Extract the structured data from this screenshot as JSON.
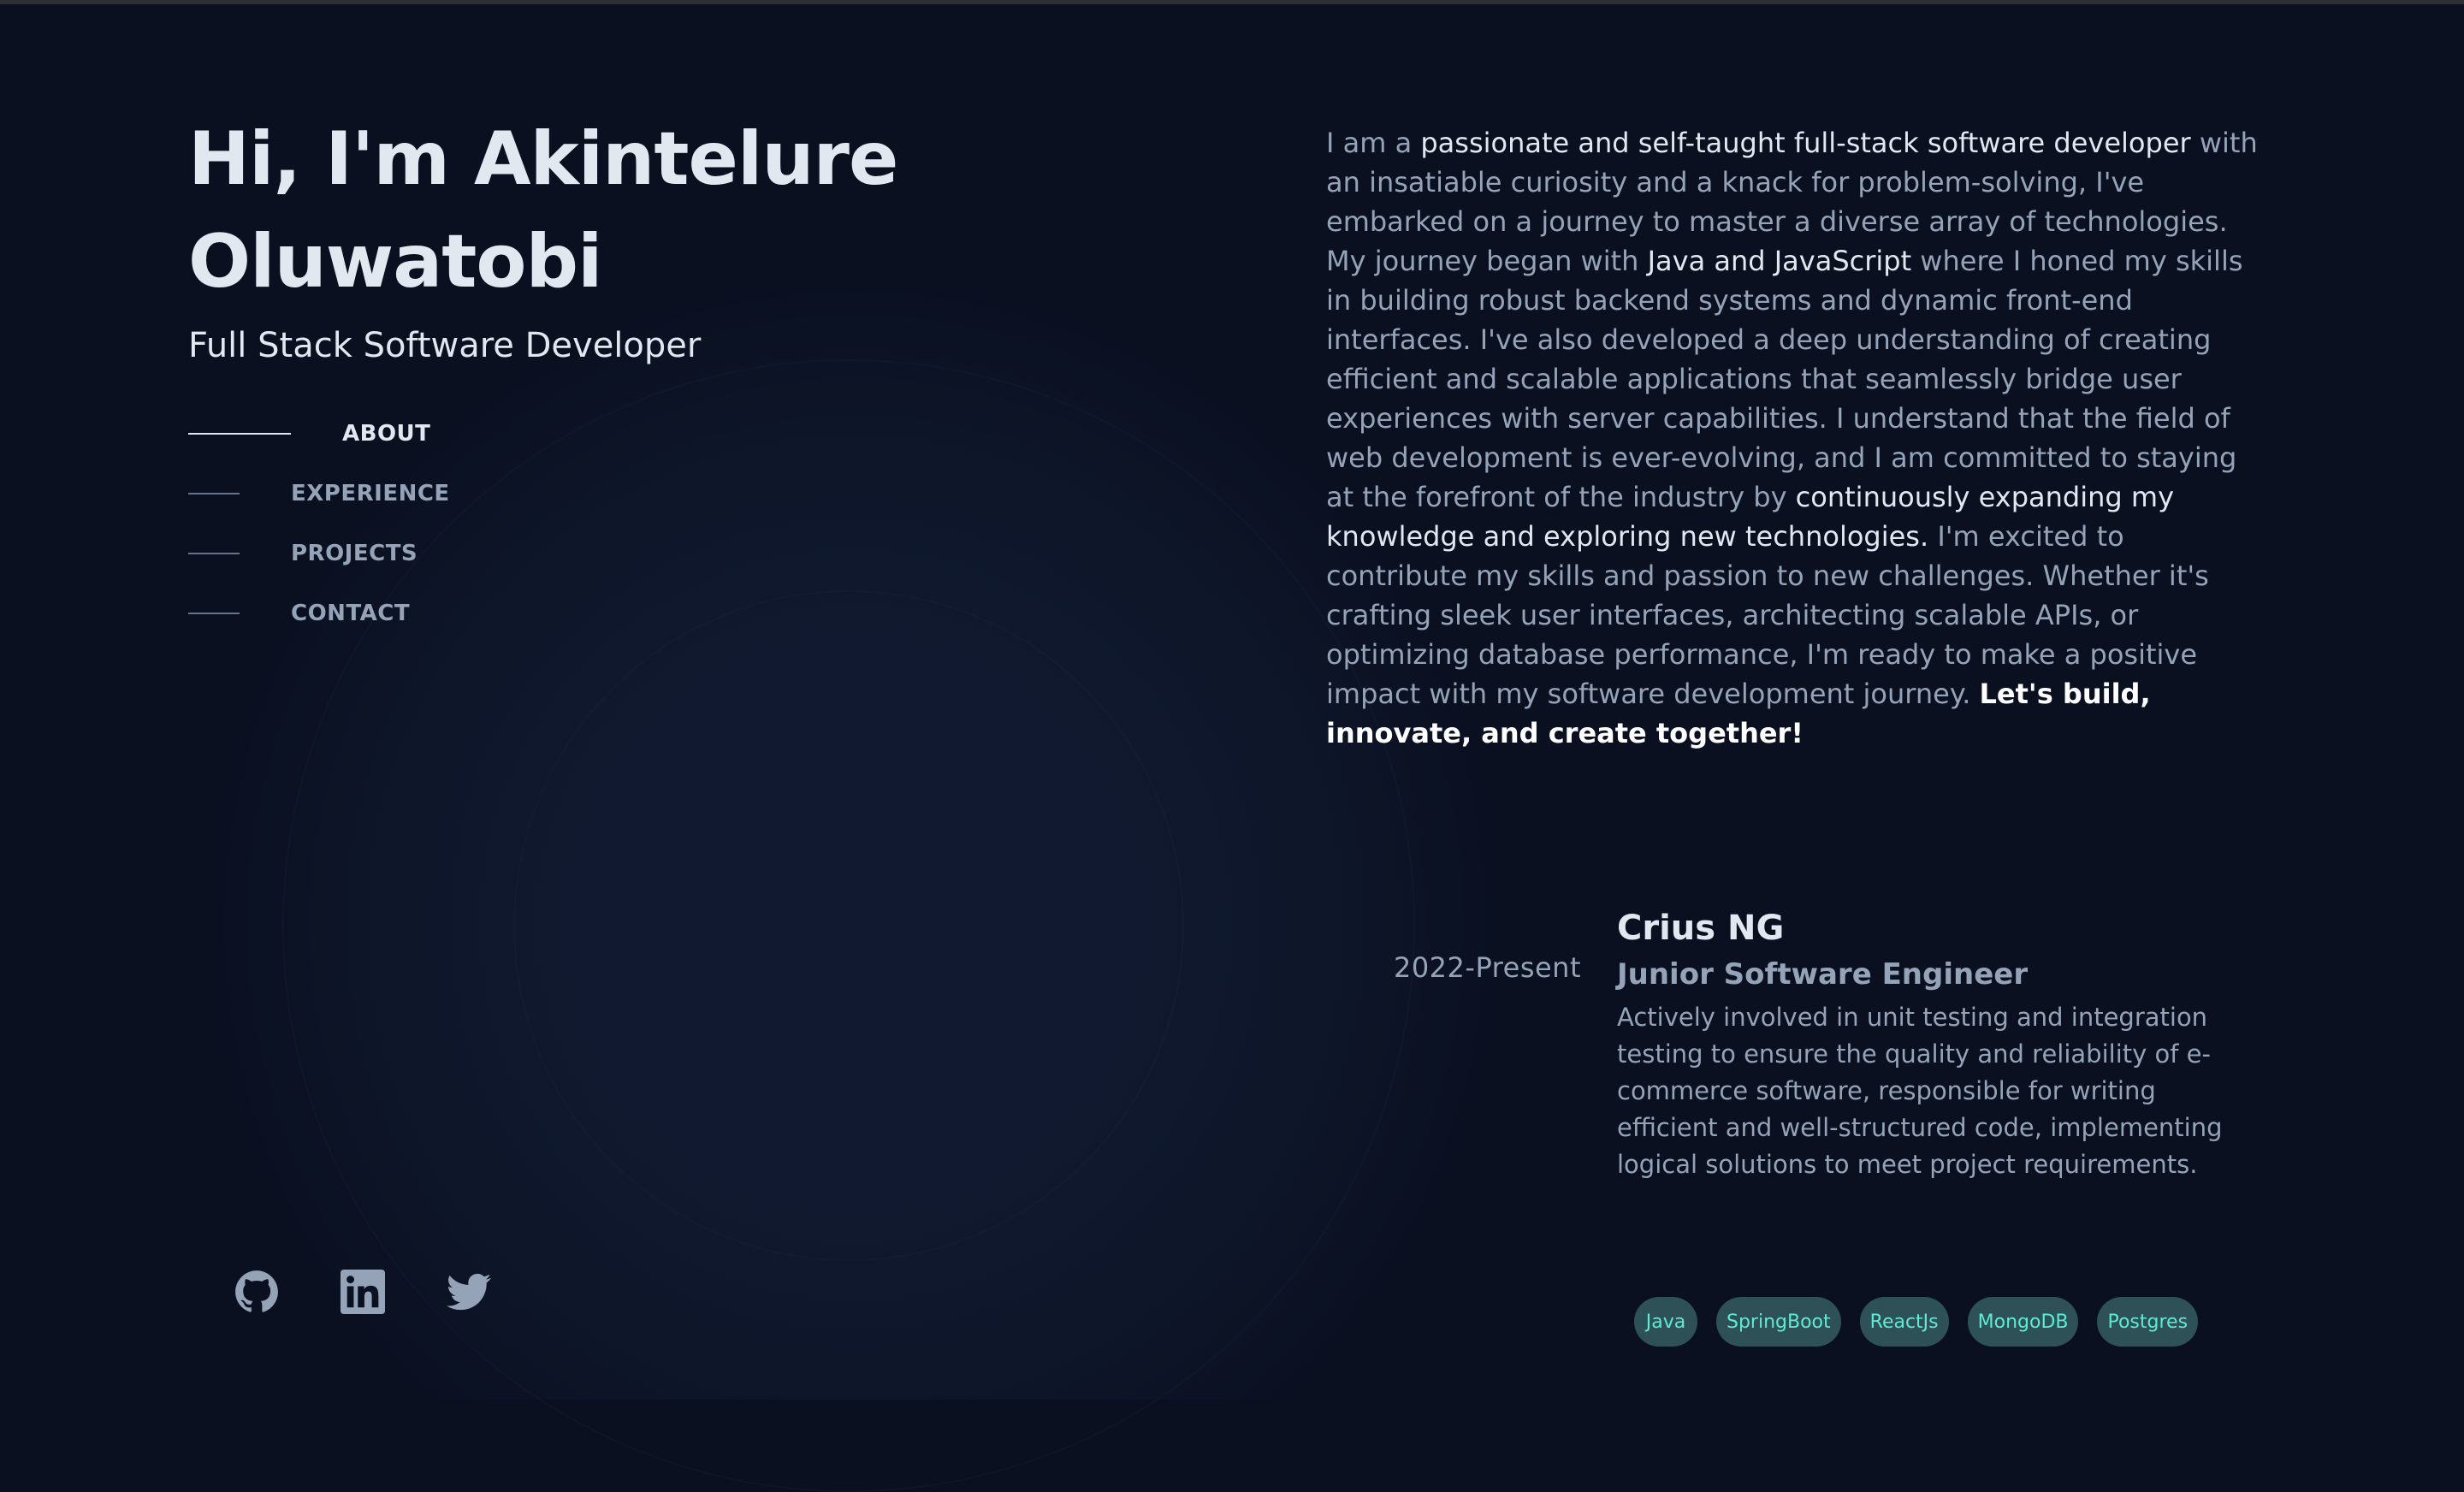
{
  "intro": {
    "greeting": "Hi, I'm Akintelure Oluwatobi",
    "subtitle": "Full Stack Software Developer"
  },
  "nav": {
    "items": [
      {
        "label": "ABOUT",
        "active": true
      },
      {
        "label": "EXPERIENCE",
        "active": false
      },
      {
        "label": "PROJECTS",
        "active": false
      },
      {
        "label": "CONTACT",
        "active": false
      }
    ]
  },
  "social": {
    "icons": [
      "github-icon",
      "linkedin-icon",
      "twitter-icon"
    ]
  },
  "about": {
    "segments": [
      {
        "text": "I am a ",
        "style": "normal"
      },
      {
        "text": "passionate and self-taught full-stack software developer",
        "style": "highlight"
      },
      {
        "text": " with an insatiable curiosity and a knack for problem-solving, I've embarked on a journey to master a diverse array of technologies. My journey began with ",
        "style": "normal"
      },
      {
        "text": "Java and JavaScript",
        "style": "highlight"
      },
      {
        "text": " where I honed my skills in building robust backend systems and dynamic front-end interfaces. I've also developed a deep understanding of creating efficient and scalable applications that seamlessly bridge user experiences with server capabilities. I understand that the field of web development is ever-evolving, and I am committed to staying at the forefront of the industry by ",
        "style": "normal"
      },
      {
        "text": "continuously expanding my knowledge and exploring new technologies.",
        "style": "highlight"
      },
      {
        "text": " I'm excited to contribute my skills and passion to new challenges. Whether it's crafting sleek user interfaces, architecting scalable APIs, or optimizing database performance, I'm ready to make a positive impact with my software development journey. ",
        "style": "normal"
      },
      {
        "text": "Let's build, innovate, and create together!",
        "style": "bold"
      }
    ]
  },
  "experience": {
    "date": "2022-Present",
    "company": "Crius NG",
    "role": "Junior Software Engineer",
    "description": "Actively involved in unit testing and integration testing to ensure the quality and reliability of e-commerce software, responsible for writing efficient and well-structured code, implementing logical solutions to meet project requirements.",
    "tags": [
      "Java",
      "SpringBoot",
      "ReactJs",
      "MongoDB",
      "Postgres"
    ]
  },
  "colors": {
    "background": "#0a1020",
    "text_primary": "#e2e8f0",
    "text_secondary": "#94a3b8",
    "tag_bg": "#2e5158",
    "tag_text": "#5eead4"
  }
}
